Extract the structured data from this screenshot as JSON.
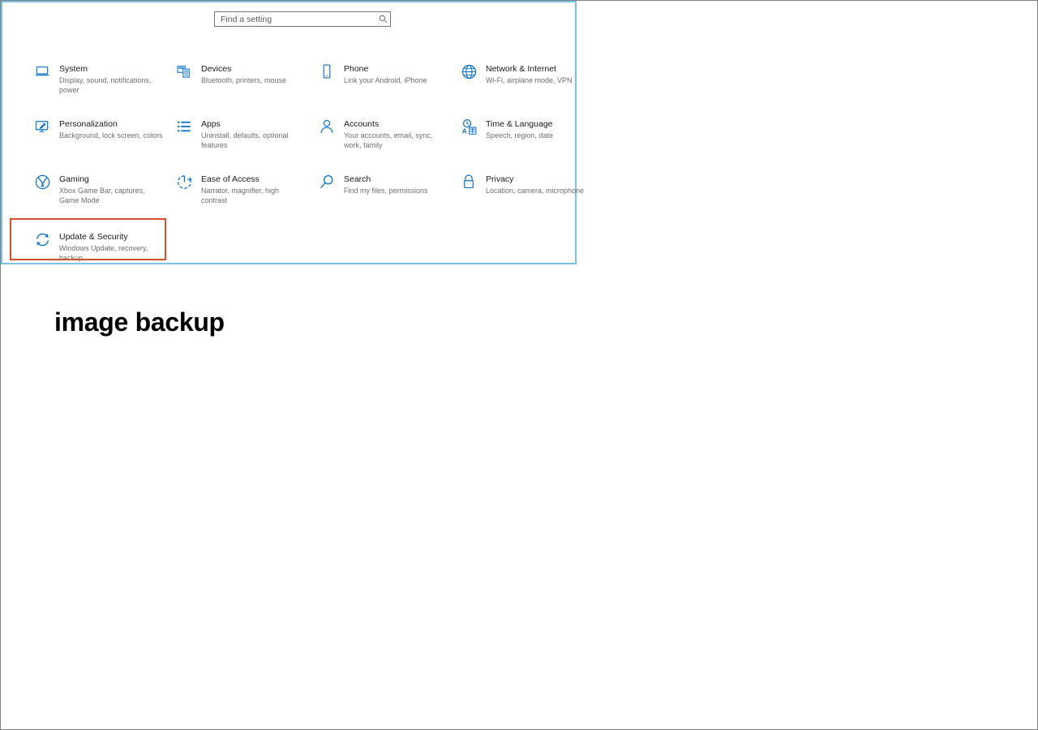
{
  "page": {
    "caption": "image backup",
    "highlight_color": "#d4502b",
    "panel_border_color": "#78c4e6",
    "accent_color": "#0a71c8"
  },
  "search": {
    "placeholder": "Find a setting",
    "value": "",
    "icon": "search-icon"
  },
  "tiles": [
    {
      "id": "system",
      "icon": "laptop-icon",
      "title": "System",
      "subtitle": "Display, sound, notifications, power"
    },
    {
      "id": "devices",
      "icon": "devices-icon",
      "title": "Devices",
      "subtitle": "Bluetooth, printers, mouse"
    },
    {
      "id": "phone",
      "icon": "phone-icon",
      "title": "Phone",
      "subtitle": "Link your Android, iPhone"
    },
    {
      "id": "network-internet",
      "icon": "globe-icon",
      "title": "Network & Internet",
      "subtitle": "Wi-Fi, airplane mode, VPN"
    },
    {
      "id": "personalization",
      "icon": "monitor-brush-icon",
      "title": "Personalization",
      "subtitle": "Background, lock screen, colors"
    },
    {
      "id": "apps",
      "icon": "list-icon",
      "title": "Apps",
      "subtitle": "Uninstall, defaults, optional features"
    },
    {
      "id": "accounts",
      "icon": "person-icon",
      "title": "Accounts",
      "subtitle": "Your accounts, email, sync, work, family"
    },
    {
      "id": "time-language",
      "icon": "clock-language-icon",
      "title": "Time & Language",
      "subtitle": "Speech, region, date"
    },
    {
      "id": "gaming",
      "icon": "xbox-icon",
      "title": "Gaming",
      "subtitle": "Xbox Game Bar, captures, Game Mode"
    },
    {
      "id": "ease-of-access",
      "icon": "accessibility-clock-icon",
      "title": "Ease of Access",
      "subtitle": "Narrator, magnifier, high contrast"
    },
    {
      "id": "search",
      "icon": "magnifier-icon",
      "title": "Search",
      "subtitle": "Find my files, permissions"
    },
    {
      "id": "privacy",
      "icon": "lock-icon",
      "title": "Privacy",
      "subtitle": "Location, camera, microphone"
    },
    {
      "id": "update-security",
      "icon": "refresh-circle-icon",
      "title": "Update & Security",
      "subtitle": "Windows Update, recovery, backup",
      "highlighted": true
    }
  ]
}
